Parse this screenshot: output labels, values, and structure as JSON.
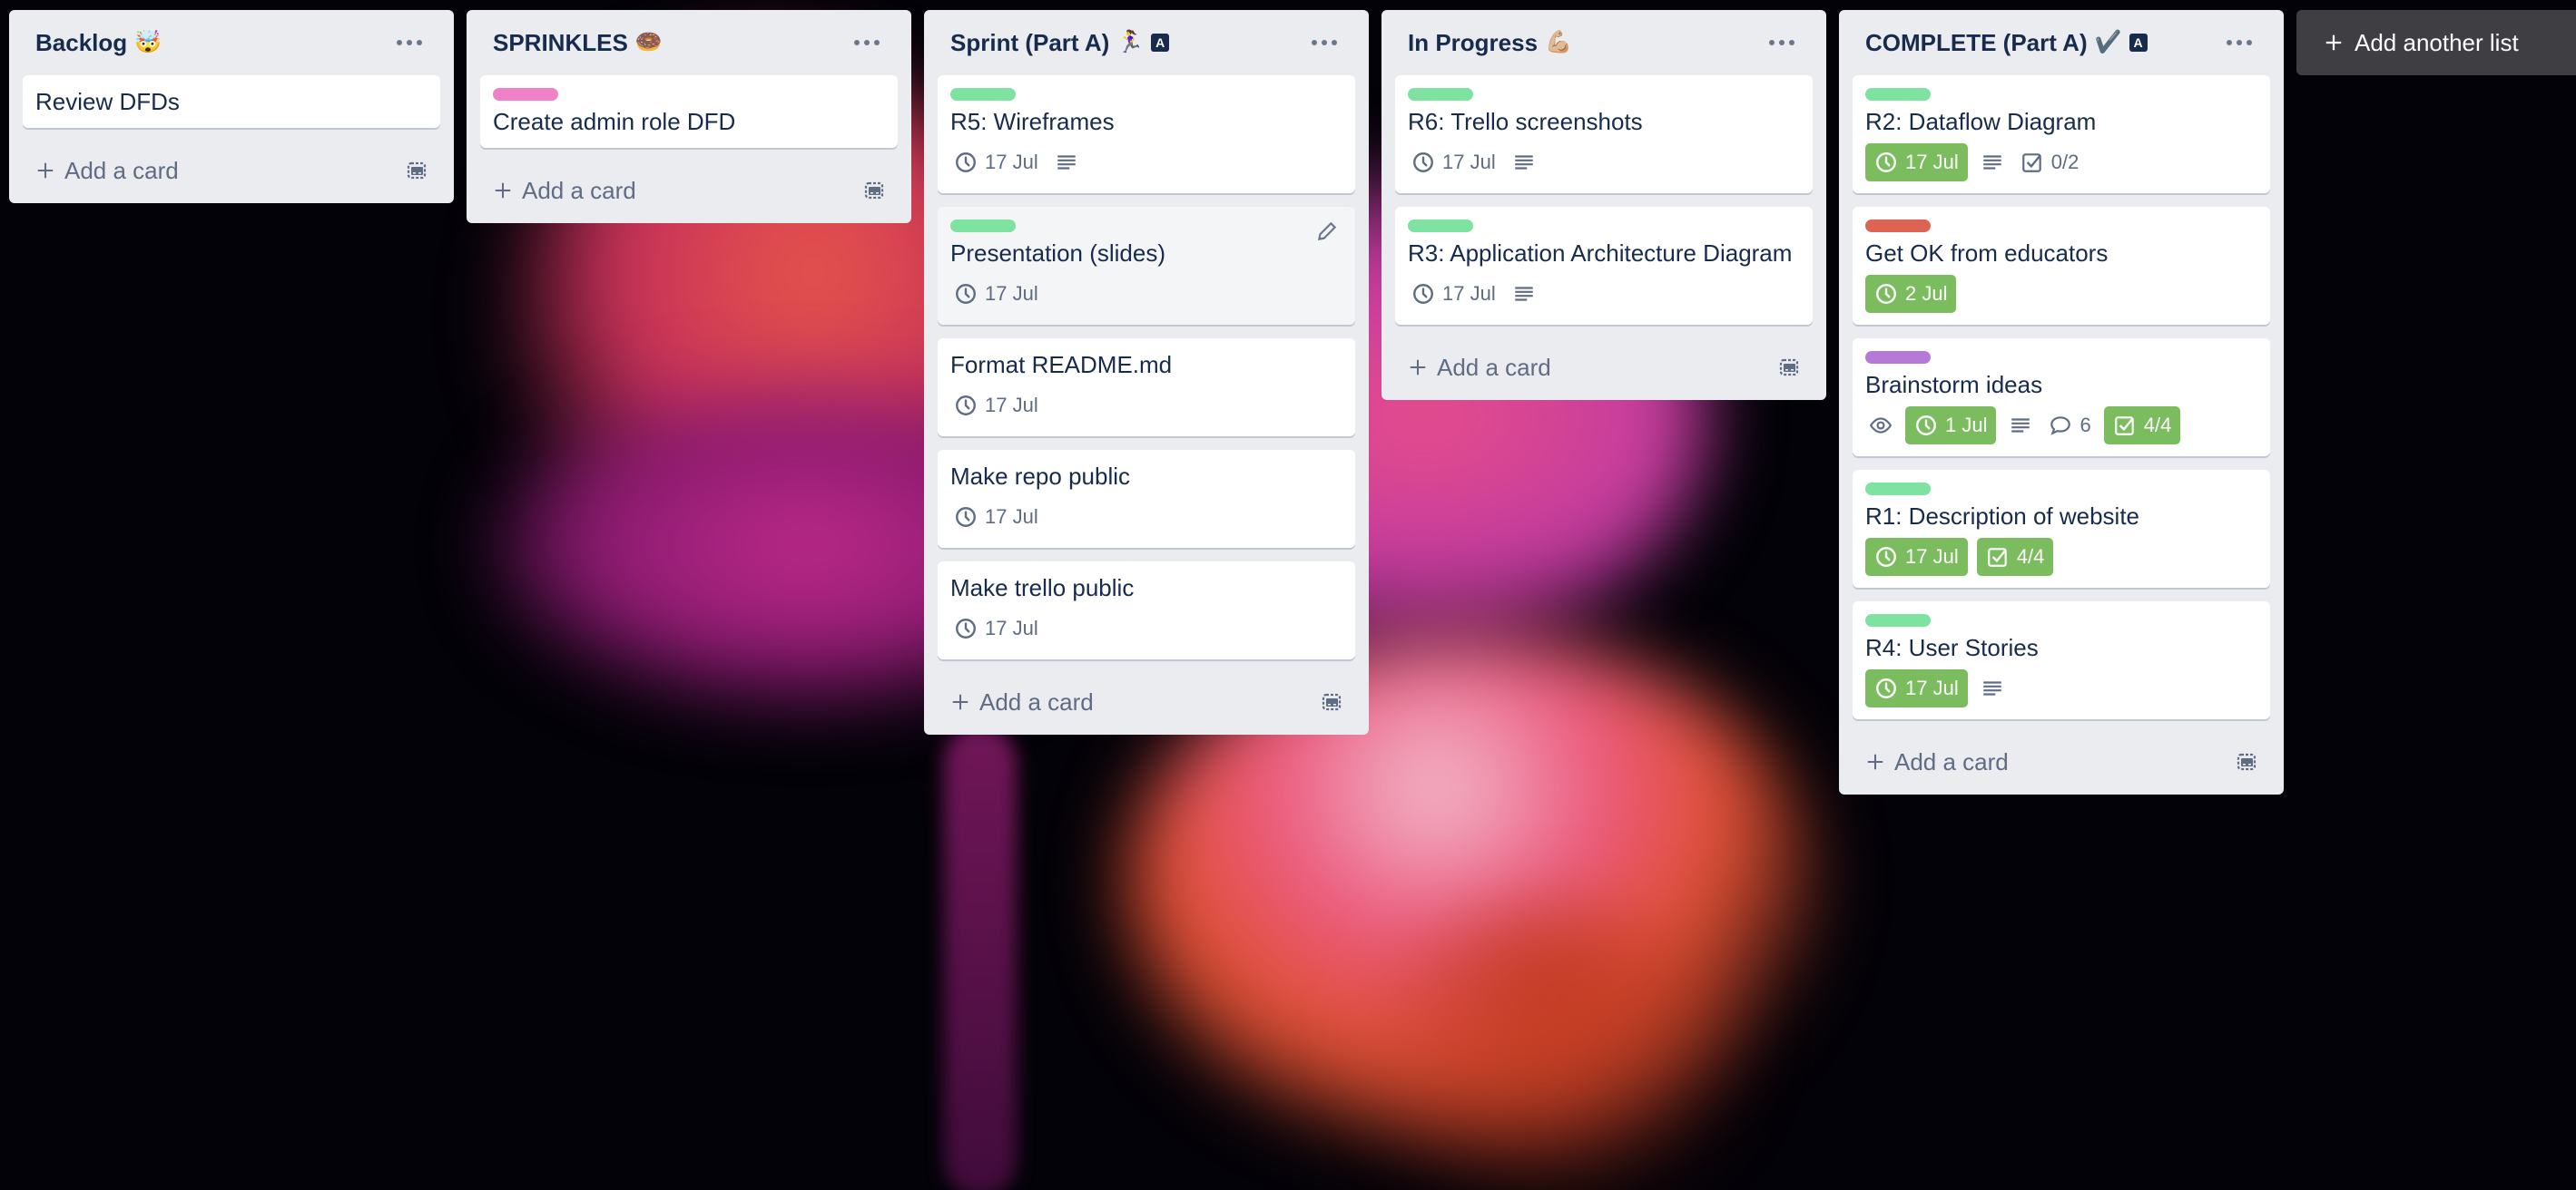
{
  "board": {
    "add_list_label": "Add another list",
    "colors": {
      "list_bg": "#ebecf0",
      "card_bg": "#ffffff",
      "text": "#172b4d",
      "muted": "#5e6c84",
      "badge_complete": "#7bbd5e",
      "label_green": "#7ee2a0",
      "label_pink": "#f081c8",
      "label_red": "#dd6352",
      "label_purple": "#b57ad8"
    }
  },
  "lists": [
    {
      "title": "Backlog",
      "emoji": "🤯",
      "add_card_label": "Add a card",
      "cards": [
        {
          "title": "Review DFDs"
        }
      ]
    },
    {
      "title": "SPRINKLES",
      "emoji": "🍩",
      "add_card_label": "Add a card",
      "cards": [
        {
          "title": "Create admin role DFD",
          "label": "pink"
        }
      ]
    },
    {
      "title": "Sprint (Part A)",
      "emoji": "🏃‍♀️",
      "chip": "A",
      "add_card_label": "Add a card",
      "cards": [
        {
          "title": "R5: Wireframes",
          "label": "green",
          "due": "17 Jul",
          "description": true
        },
        {
          "title": "Presentation (slides)",
          "label": "green",
          "due": "17 Jul",
          "hovered": true
        },
        {
          "title": "Format README.md",
          "due": "17 Jul"
        },
        {
          "title": "Make repo public",
          "due": "17 Jul"
        },
        {
          "title": "Make trello public",
          "due": "17 Jul"
        }
      ]
    },
    {
      "title": "In Progress",
      "emoji": "💪🏼",
      "add_card_label": "Add a card",
      "cards": [
        {
          "title": "R6: Trello screenshots",
          "label": "green",
          "due": "17 Jul",
          "description": true
        },
        {
          "title": "R3: Application Architecture Diagram",
          "label": "green",
          "due": "17 Jul",
          "description": true
        }
      ]
    },
    {
      "title": "COMPLETE (Part A)",
      "emoji": "✔️",
      "chip": "A",
      "add_card_label": "Add a card",
      "cards": [
        {
          "title": "R2: Dataflow Diagram",
          "label": "green",
          "due": "17 Jul",
          "due_complete": true,
          "description": true,
          "checklist": "0/2"
        },
        {
          "title": "Get OK from educators",
          "label": "red",
          "due": "2 Jul",
          "due_complete": true
        },
        {
          "title": "Brainstorm ideas",
          "label": "purple",
          "watching": true,
          "due": "1 Jul",
          "due_complete": true,
          "description": true,
          "comments": "6",
          "checklist": "4/4",
          "checklist_complete": true
        },
        {
          "title": "R1: Description of website",
          "label": "green",
          "due": "17 Jul",
          "due_complete": true,
          "checklist": "4/4",
          "checklist_complete": true
        },
        {
          "title": "R4: User Stories",
          "label": "green",
          "due": "17 Jul",
          "due_complete": true,
          "description": true
        }
      ]
    }
  ]
}
